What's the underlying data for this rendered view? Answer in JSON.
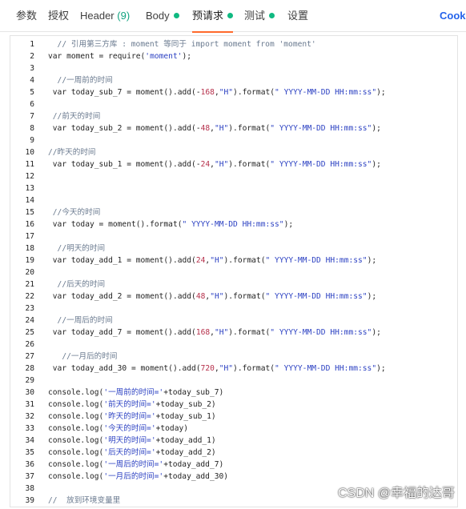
{
  "tabs": [
    {
      "label": "参数"
    },
    {
      "label": "授权"
    },
    {
      "label": "Header",
      "count": "(9)"
    },
    {
      "label": "Body"
    },
    {
      "label": "预请求"
    },
    {
      "label": "测试"
    },
    {
      "label": "设置"
    },
    {
      "label": "Cooki"
    }
  ],
  "colors": {
    "accent": "#ff6a2c",
    "dot": "#10b981",
    "count": "#10a37f",
    "link": "#2563eb"
  },
  "code": {
    "lines": [
      {
        "n": "1",
        "tokens": [
          {
            "c": "cm",
            "t": "  // 引用第三方库 : moment 等同于 import moment from 'moment'"
          }
        ]
      },
      {
        "n": "2",
        "tokens": [
          {
            "c": "kw",
            "t": "var moment = require("
          },
          {
            "c": "str",
            "t": "'moment'"
          },
          {
            "c": "kw",
            "t": ");"
          }
        ]
      },
      {
        "n": "3",
        "tokens": []
      },
      {
        "n": "4",
        "tokens": [
          {
            "c": "cm",
            "t": "  //一周前的时间"
          }
        ]
      },
      {
        "n": "5",
        "tokens": [
          {
            "c": "kw",
            "t": " var today_sub_7 = moment().add(-"
          },
          {
            "c": "num",
            "t": "168"
          },
          {
            "c": "kw",
            "t": ","
          },
          {
            "c": "str",
            "t": "\"H\""
          },
          {
            "c": "kw",
            "t": ").format("
          },
          {
            "c": "str",
            "t": "\" YYYY-MM-DD HH:mm:ss\""
          },
          {
            "c": "kw",
            "t": ");"
          }
        ]
      },
      {
        "n": "6",
        "tokens": []
      },
      {
        "n": "7",
        "tokens": [
          {
            "c": "cm",
            "t": " //前天的时间"
          }
        ]
      },
      {
        "n": "8",
        "tokens": [
          {
            "c": "kw",
            "t": " var today_sub_2 = moment().add(-"
          },
          {
            "c": "num",
            "t": "48"
          },
          {
            "c": "kw",
            "t": ","
          },
          {
            "c": "str",
            "t": "\"H\""
          },
          {
            "c": "kw",
            "t": ").format("
          },
          {
            "c": "str",
            "t": "\" YYYY-MM-DD HH:mm:ss\""
          },
          {
            "c": "kw",
            "t": ");"
          }
        ]
      },
      {
        "n": "9",
        "tokens": []
      },
      {
        "n": "10",
        "tokens": [
          {
            "c": "cm",
            "t": "//昨天的时间"
          }
        ]
      },
      {
        "n": "11",
        "tokens": [
          {
            "c": "kw",
            "t": " var today_sub_1 = moment().add(-"
          },
          {
            "c": "num",
            "t": "24"
          },
          {
            "c": "kw",
            "t": ","
          },
          {
            "c": "str",
            "t": "\"H\""
          },
          {
            "c": "kw",
            "t": ").format("
          },
          {
            "c": "str",
            "t": "\" YYYY-MM-DD HH:mm:ss\""
          },
          {
            "c": "kw",
            "t": ");"
          }
        ]
      },
      {
        "n": "12",
        "tokens": []
      },
      {
        "n": "13",
        "tokens": []
      },
      {
        "n": "14",
        "tokens": []
      },
      {
        "n": "15",
        "tokens": [
          {
            "c": "cm",
            "t": " //今天的时间"
          }
        ]
      },
      {
        "n": "16",
        "tokens": [
          {
            "c": "kw",
            "t": " var today = moment().format("
          },
          {
            "c": "str",
            "t": "\" YYYY-MM-DD HH:mm:ss\""
          },
          {
            "c": "kw",
            "t": ");"
          }
        ]
      },
      {
        "n": "17",
        "tokens": []
      },
      {
        "n": "18",
        "tokens": [
          {
            "c": "cm",
            "t": "  //明天的时间"
          }
        ]
      },
      {
        "n": "19",
        "tokens": [
          {
            "c": "kw",
            "t": " var today_add_1 = moment().add("
          },
          {
            "c": "num",
            "t": "24"
          },
          {
            "c": "kw",
            "t": ","
          },
          {
            "c": "str",
            "t": "\"H\""
          },
          {
            "c": "kw",
            "t": ").format("
          },
          {
            "c": "str",
            "t": "\" YYYY-MM-DD HH:mm:ss\""
          },
          {
            "c": "kw",
            "t": ");"
          }
        ]
      },
      {
        "n": "20",
        "tokens": []
      },
      {
        "n": "21",
        "tokens": [
          {
            "c": "cm",
            "t": "  //后天的时间"
          }
        ]
      },
      {
        "n": "22",
        "tokens": [
          {
            "c": "kw",
            "t": " var today_add_2 = moment().add("
          },
          {
            "c": "num",
            "t": "48"
          },
          {
            "c": "kw",
            "t": ","
          },
          {
            "c": "str",
            "t": "\"H\""
          },
          {
            "c": "kw",
            "t": ").format("
          },
          {
            "c": "str",
            "t": "\" YYYY-MM-DD HH:mm:ss\""
          },
          {
            "c": "kw",
            "t": ");"
          }
        ]
      },
      {
        "n": "23",
        "tokens": []
      },
      {
        "n": "24",
        "tokens": [
          {
            "c": "cm",
            "t": "  //一周后的时间"
          }
        ]
      },
      {
        "n": "25",
        "tokens": [
          {
            "c": "kw",
            "t": " var today_add_7 = moment().add("
          },
          {
            "c": "num",
            "t": "168"
          },
          {
            "c": "kw",
            "t": ","
          },
          {
            "c": "str",
            "t": "\"H\""
          },
          {
            "c": "kw",
            "t": ").format("
          },
          {
            "c": "str",
            "t": "\" YYYY-MM-DD HH:mm:ss\""
          },
          {
            "c": "kw",
            "t": ");"
          }
        ]
      },
      {
        "n": "26",
        "tokens": []
      },
      {
        "n": "27",
        "tokens": [
          {
            "c": "cm",
            "t": "   //一月后的时间"
          }
        ]
      },
      {
        "n": "28",
        "tokens": [
          {
            "c": "kw",
            "t": " var today_add_30 = moment().add("
          },
          {
            "c": "num",
            "t": "720"
          },
          {
            "c": "kw",
            "t": ","
          },
          {
            "c": "str",
            "t": "\"H\""
          },
          {
            "c": "kw",
            "t": ").format("
          },
          {
            "c": "str",
            "t": "\" YYYY-MM-DD HH:mm:ss\""
          },
          {
            "c": "kw",
            "t": ");"
          }
        ]
      },
      {
        "n": "29",
        "tokens": []
      },
      {
        "n": "30",
        "tokens": [
          {
            "c": "kw",
            "t": "console.log("
          },
          {
            "c": "str",
            "t": "'一周前的时间='"
          },
          {
            "c": "kw",
            "t": "+today_sub_7)"
          }
        ]
      },
      {
        "n": "31",
        "tokens": [
          {
            "c": "kw",
            "t": "console.log("
          },
          {
            "c": "str",
            "t": "'前天的时间='"
          },
          {
            "c": "kw",
            "t": "+today_sub_2)"
          }
        ]
      },
      {
        "n": "32",
        "tokens": [
          {
            "c": "kw",
            "t": "console.log("
          },
          {
            "c": "str",
            "t": "'昨天的时间='"
          },
          {
            "c": "kw",
            "t": "+today_sub_1)"
          }
        ]
      },
      {
        "n": "33",
        "tokens": [
          {
            "c": "kw",
            "t": "console.log("
          },
          {
            "c": "str",
            "t": "'今天的时间='"
          },
          {
            "c": "kw",
            "t": "+today)"
          }
        ]
      },
      {
        "n": "34",
        "tokens": [
          {
            "c": "kw",
            "t": "console.log("
          },
          {
            "c": "str",
            "t": "'明天的时间='"
          },
          {
            "c": "kw",
            "t": "+today_add_1)"
          }
        ]
      },
      {
        "n": "35",
        "tokens": [
          {
            "c": "kw",
            "t": "console.log("
          },
          {
            "c": "str",
            "t": "'后天的时间='"
          },
          {
            "c": "kw",
            "t": "+today_add_2)"
          }
        ]
      },
      {
        "n": "36",
        "tokens": [
          {
            "c": "kw",
            "t": "console.log("
          },
          {
            "c": "str",
            "t": "'一周后的时间='"
          },
          {
            "c": "kw",
            "t": "+today_add_7)"
          }
        ]
      },
      {
        "n": "37",
        "tokens": [
          {
            "c": "kw",
            "t": "console.log("
          },
          {
            "c": "str",
            "t": "'一月后的时间='"
          },
          {
            "c": "kw",
            "t": "+today_add_30)"
          }
        ]
      },
      {
        "n": "38",
        "tokens": []
      },
      {
        "n": "39",
        "tokens": [
          {
            "c": "cm",
            "t": "//  放到环境变量里"
          }
        ]
      }
    ]
  },
  "watermark": "CSDN @幸福的达哥"
}
